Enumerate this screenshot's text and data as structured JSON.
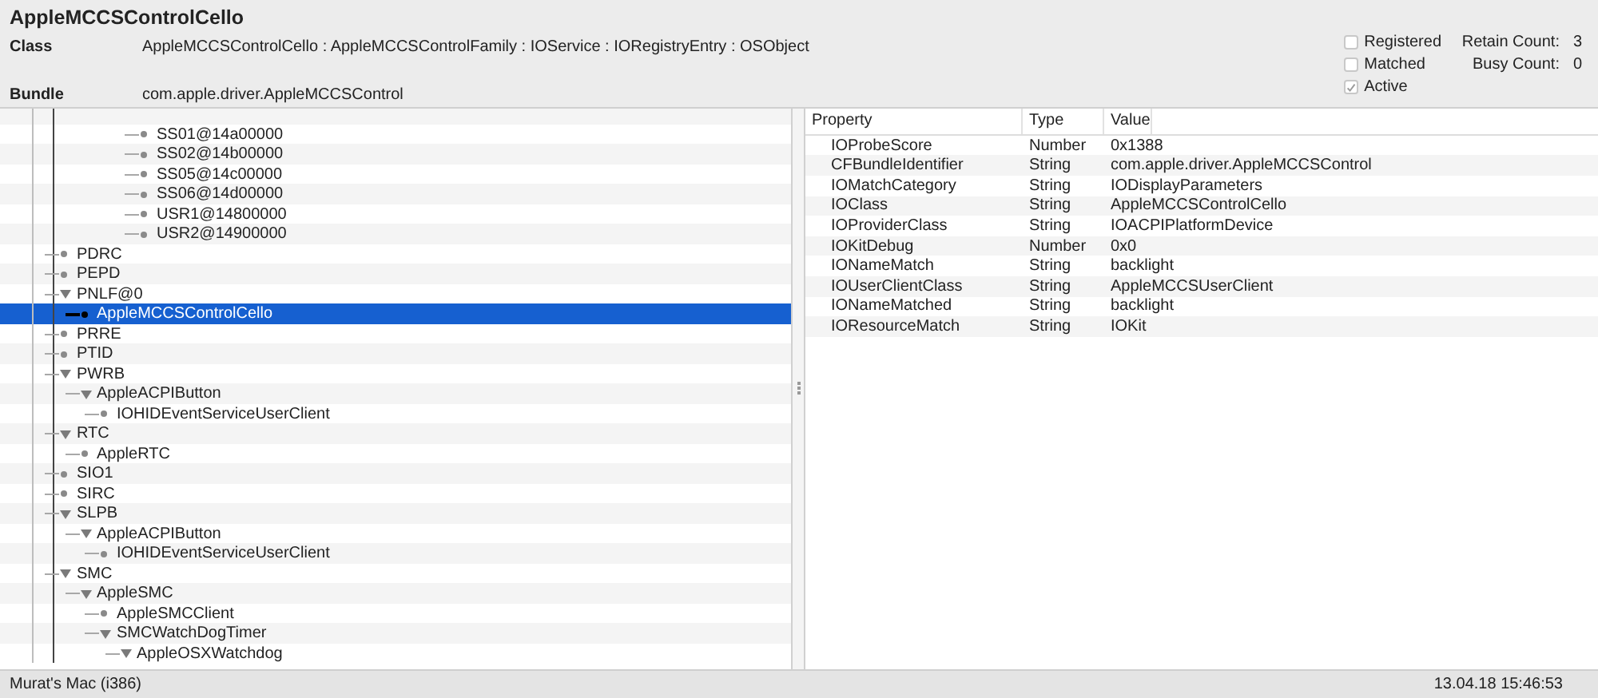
{
  "title": "AppleMCCSControlCello",
  "info": [
    {
      "label": "Class",
      "value": "AppleMCCSControlCello : AppleMCCSControlFamily : IOService : IORegistryEntry : OSObject"
    },
    {
      "label": "Bundle",
      "value": "com.apple.driver.AppleMCCSControl"
    }
  ],
  "flags": [
    {
      "label": "Registered",
      "checked": false
    },
    {
      "label": "Matched",
      "checked": false
    },
    {
      "label": "Active",
      "checked": true
    }
  ],
  "counts": [
    {
      "label": "Retain Count:",
      "value": "3"
    },
    {
      "label": "Busy Count:",
      "value": "0"
    }
  ],
  "tree": {
    "cut_off_branch": [
      {
        "label": "SS01@14a00000",
        "selected": false
      },
      {
        "label": "SS02@14b00000",
        "selected": false
      },
      {
        "label": "SS05@14c00000",
        "selected": false
      },
      {
        "label": "SS06@14d00000",
        "selected": false
      },
      {
        "label": "USR1@14800000",
        "selected": false
      },
      {
        "label": "USR2@14900000",
        "selected": false
      }
    ],
    "items": [
      {
        "label": "PDRC",
        "selected": false
      },
      {
        "label": "PEPD",
        "selected": false
      },
      {
        "label": "PNLF@0",
        "selected": false,
        "expanded": true,
        "children": [
          {
            "label": "AppleMCCSControlCello",
            "selected": true
          }
        ]
      },
      {
        "label": "PRRE",
        "selected": false
      },
      {
        "label": "PTID",
        "selected": false
      },
      {
        "label": "PWRB",
        "selected": false,
        "expanded": true,
        "children": [
          {
            "label": "AppleACPIButton",
            "selected": false,
            "expanded": true,
            "children": [
              {
                "label": "IOHIDEventServiceUserClient",
                "selected": false
              }
            ]
          }
        ]
      },
      {
        "label": "RTC",
        "selected": false,
        "expanded": true,
        "children": [
          {
            "label": "AppleRTC",
            "selected": false
          }
        ]
      },
      {
        "label": "SIO1",
        "selected": false
      },
      {
        "label": "SIRC",
        "selected": false
      },
      {
        "label": "SLPB",
        "selected": false,
        "expanded": true,
        "children": [
          {
            "label": "AppleACPIButton",
            "selected": false,
            "expanded": true,
            "children": [
              {
                "label": "IOHIDEventServiceUserClient",
                "selected": false
              }
            ]
          }
        ]
      },
      {
        "label": "SMC",
        "selected": false,
        "expanded": true,
        "children": [
          {
            "label": "AppleSMC",
            "selected": false,
            "expanded": true,
            "children": [
              {
                "label": "AppleSMCClient",
                "selected": false
              },
              {
                "label": "SMCWatchDogTimer",
                "selected": false,
                "expanded": true,
                "children": [
                  {
                    "label": "AppleOSXWatchdog",
                    "selected": false,
                    "expanded": true
                  }
                ]
              }
            ]
          }
        ]
      }
    ]
  },
  "properties": {
    "columns": [
      "Property",
      "Type",
      "Value"
    ],
    "rows": [
      [
        "IOProbeScore",
        "Number",
        "0x1388"
      ],
      [
        "CFBundleIdentifier",
        "String",
        "com.apple.driver.AppleMCCSControl"
      ],
      [
        "IOMatchCategory",
        "String",
        "IODisplayParameters"
      ],
      [
        "IOClass",
        "String",
        "AppleMCCSControlCello"
      ],
      [
        "IOProviderClass",
        "String",
        "IOACPIPlatformDevice"
      ],
      [
        "IOKitDebug",
        "Number",
        "0x0"
      ],
      [
        "IONameMatch",
        "String",
        "backlight"
      ],
      [
        "IOUserClientClass",
        "String",
        "AppleMCCSUserClient"
      ],
      [
        "IONameMatched",
        "String",
        "backlight"
      ],
      [
        "IOResourceMatch",
        "String",
        "IOKit"
      ]
    ]
  },
  "status_bar": {
    "machine": "Murat's Mac (i386)",
    "timestamp": "13.04.18 15:46:53"
  }
}
